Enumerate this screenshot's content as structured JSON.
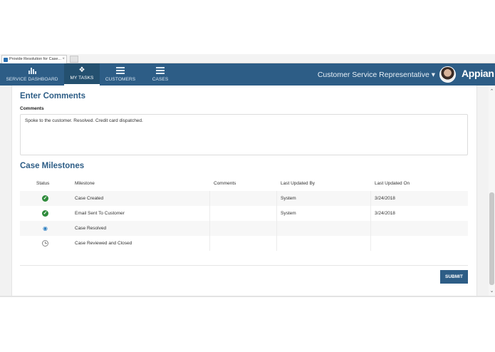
{
  "browser": {
    "tab_title": "Provide Resolution for Case..."
  },
  "nav": {
    "items": [
      {
        "label": "SERVICE DASHBOARD",
        "icon": "bar-chart-icon"
      },
      {
        "label": "MY TASKS",
        "icon": "tag-icon",
        "active": true
      },
      {
        "label": "CUSTOMERS",
        "icon": "list-icon"
      },
      {
        "label": "CASES",
        "icon": "list-icon"
      }
    ],
    "role": "Customer Service Representative ▾",
    "brand": "Appian",
    "color": "#2d5d86"
  },
  "comments_section": {
    "title": "Enter Comments",
    "field_label": "Comments",
    "value": "Spoke to the customer. Resolved. Credit card dispatched."
  },
  "milestones": {
    "title": "Case Milestones",
    "columns": [
      "Status",
      "Milestone",
      "Comments",
      "Last Updated By",
      "Last Updated On"
    ],
    "rows": [
      {
        "status_icon": "check-circle-icon",
        "milestone": "Case Created",
        "comments": "",
        "updated_by": "System",
        "updated_on": "3/24/2018"
      },
      {
        "status_icon": "check-circle-icon",
        "milestone": "Email Sent To Customer",
        "comments": "",
        "updated_by": "System",
        "updated_on": "3/24/2018"
      },
      {
        "status_icon": "eye-icon",
        "milestone": "Case Resolved",
        "comments": "",
        "updated_by": "",
        "updated_on": ""
      },
      {
        "status_icon": "clock-icon",
        "milestone": "Case Reviewed and Closed",
        "comments": "",
        "updated_by": "",
        "updated_on": ""
      }
    ]
  },
  "actions": {
    "submit_label": "SUBMIT"
  }
}
